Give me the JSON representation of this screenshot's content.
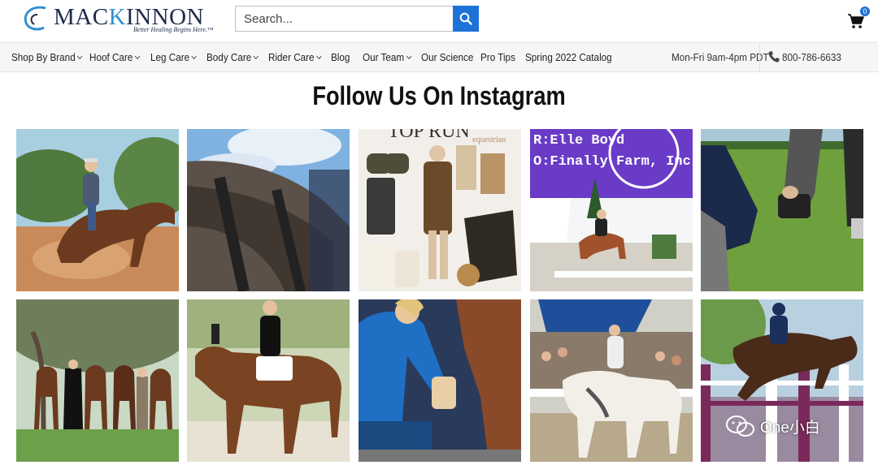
{
  "brand": {
    "logo_text_part1": "MAC",
    "logo_text_k": "K",
    "logo_text_part2": "INNON",
    "tagline": "Better Healing Begins Here.™"
  },
  "search": {
    "placeholder": "Search..."
  },
  "cart": {
    "count": "0"
  },
  "nav": {
    "items": [
      {
        "label": "Shop By Brand",
        "dropdown": true
      },
      {
        "label": "Hoof Care",
        "dropdown": true
      },
      {
        "label": "Leg Care",
        "dropdown": true
      },
      {
        "label": "Body Care",
        "dropdown": true
      },
      {
        "label": "Rider Care",
        "dropdown": true
      },
      {
        "label": "Blog",
        "dropdown": false
      },
      {
        "label": "Our Team",
        "dropdown": true
      },
      {
        "label": "Our Science",
        "dropdown": false
      },
      {
        "label": "Pro Tips",
        "dropdown": false
      },
      {
        "label": "Spring 2022 Catalog",
        "dropdown": false
      }
    ],
    "hours": "Mon-Fri 9am-4pm PDT",
    "phone": "800-786-6633"
  },
  "section": {
    "title": "Follow Us On Instagram"
  },
  "instagram": {
    "tile3_overlay": "TOP RUN",
    "tile3_overlay_small": "equestrian",
    "tile4_line1": "R:Elle Boyd",
    "tile4_line2": "O:Finally Farm, Inc"
  },
  "watermark": {
    "text": "One小白"
  },
  "colors": {
    "accent": "#1d72d8",
    "brand_navy": "#1d2a4a",
    "brand_blue": "#2f8fd0"
  }
}
